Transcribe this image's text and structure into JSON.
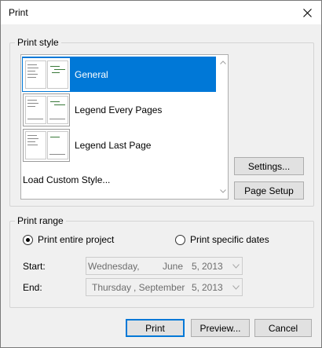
{
  "window": {
    "title": "Print",
    "close_icon": "close-icon"
  },
  "print_style": {
    "legend": "Print style",
    "items": [
      {
        "label": "General",
        "selected": true
      },
      {
        "label": "Legend Every Pages",
        "selected": false
      },
      {
        "label": "Legend Last Page",
        "selected": false
      }
    ],
    "load_custom": "Load Custom Style..."
  },
  "buttons": {
    "settings": "Settings...",
    "page_setup": "Page Setup",
    "print": "Print",
    "preview": "Preview...",
    "cancel": "Cancel"
  },
  "print_range": {
    "legend": "Print range",
    "entire_project": "Print entire project",
    "specific_dates": "Print specific dates",
    "selected": "entire_project",
    "start": {
      "label": "Start:",
      "weekday": "Wednesday,",
      "month": "June",
      "day": "5,",
      "year": "2013"
    },
    "end": {
      "label": "End:",
      "weekday": "Thursday",
      "month": ", September",
      "day": "5,",
      "year": "2013"
    }
  },
  "colors": {
    "selection": "#0078d7",
    "dialog_bg": "#f0f0f0",
    "disabled_text": "#6d6d6d"
  }
}
